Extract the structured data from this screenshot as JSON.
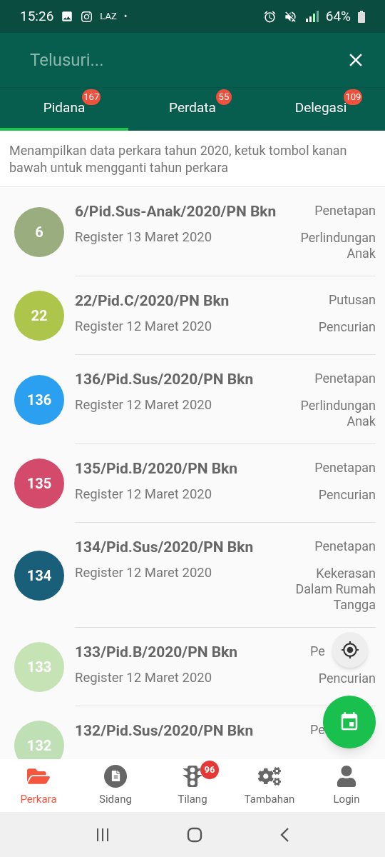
{
  "status_bar": {
    "time": "15:26",
    "carrier": "LAZ",
    "dot": "•",
    "battery": "64%"
  },
  "search": {
    "placeholder": "Telusuri..."
  },
  "tabs": [
    {
      "label": "Pidana",
      "badge": "167",
      "selected": true
    },
    {
      "label": "Perdata",
      "badge": "55",
      "selected": false
    },
    {
      "label": "Delegasi",
      "badge": "109",
      "selected": false
    }
  ],
  "info": "Menampilkan data perkara tahun 2020, ketuk tombol kanan bawah untuk mengganti tahun perkara",
  "cases": [
    {
      "number": "6",
      "title": "6/Pid.Sus-Anak/2020/PN Bkn",
      "register": "Register 13 Maret 2020",
      "status": "Penetapan",
      "category": "Perlindungan Anak",
      "color": "#9aad7f"
    },
    {
      "number": "22",
      "title": "22/Pid.C/2020/PN Bkn",
      "register": "Register 12 Maret 2020",
      "status": "Putusan",
      "category": "Pencurian",
      "color": "#acc54a"
    },
    {
      "number": "136",
      "title": "136/Pid.Sus/2020/PN Bkn",
      "register": "Register 12 Maret 2020",
      "status": "Penetapan",
      "category": "Perlindungan Anak",
      "color": "#2b9ff0"
    },
    {
      "number": "135",
      "title": "135/Pid.B/2020/PN Bkn",
      "register": "Register 12 Maret 2020",
      "status": "Penetapan",
      "category": "Pencurian",
      "color": "#d44a6a"
    },
    {
      "number": "134",
      "title": "134/Pid.Sus/2020/PN Bkn",
      "register": "Register 12 Maret 2020",
      "status": "Penetapan",
      "category": "Kekerasan Dalam Rumah Tangga",
      "color": "#1a5f7a"
    },
    {
      "number": "133",
      "title": "133/Pid.B/2020/PN Bkn",
      "register": "Register 12 Maret 2020",
      "status": "Pe",
      "status_covered": true,
      "category": "Pencurian",
      "color": "#c6e3b5"
    },
    {
      "number": "132",
      "title": "132/Pid.Sus/2020/PN Bkn",
      "status": "Pe",
      "status_covered": true,
      "color": "#bfe0b4"
    }
  ],
  "bottom_nav": [
    {
      "kind": "folder",
      "label": "Perkara",
      "selected": true
    },
    {
      "kind": "document",
      "label": "Sidang",
      "selected": false
    },
    {
      "kind": "traffic",
      "label": "Tilang",
      "badge": "96",
      "selected": false
    },
    {
      "kind": "gears",
      "label": "Tambahan",
      "selected": false
    },
    {
      "kind": "user",
      "label": "Login",
      "selected": false
    }
  ]
}
